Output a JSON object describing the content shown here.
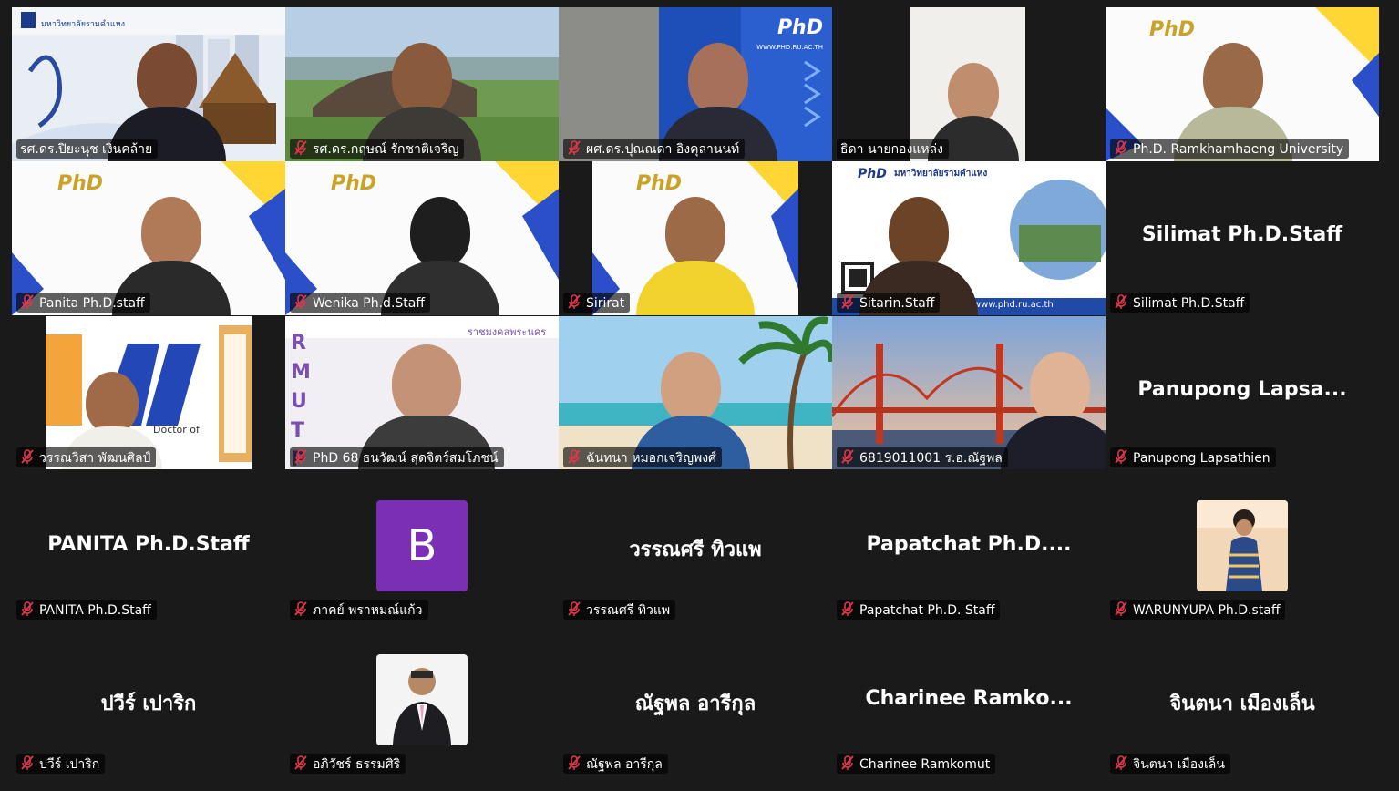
{
  "colors": {
    "background": "#1a1a1a",
    "active_speaker_border": "#3ddc84",
    "muted_icon": "#e0374a",
    "name_tag_bg": "rgba(0,0,0,0.62)",
    "avatar_b_bg": "#7b2fb5"
  },
  "icons": {
    "muted": "muted-microphone-icon"
  },
  "phd_logo_text": "PhD",
  "banner_texts": {
    "sitarin_title": "มหาวิทยาลัยรามคำแหง",
    "sitarin_url": "www.phd.ru.ac.th",
    "logo_university": "มหาวิทยาลัยรามคำแหง",
    "rmutp_letters": "RMUTP",
    "rmutp_header": "ราชมงคลพระนคร",
    "doctor_text": "Doctor of",
    "phd_url": "WWW.PHD.RU.AC.TH"
  },
  "tiles": [
    {
      "name": "รศ.ดร.ปิยะนุช เงินคล้าย",
      "muted": false,
      "active": true,
      "type": "video",
      "bg": "ramkhamhaeng-temple"
    },
    {
      "name": "รศ.ดร.กฤษณ์ รักชาติเจริญ",
      "muted": true,
      "type": "video",
      "bg": "green-campus"
    },
    {
      "name": "ผศ.ดร.ปุณณดา อิงคุลานนท์",
      "muted": true,
      "type": "video",
      "bg": "phd-blue"
    },
    {
      "name": "ธิดา นายกองแหล่ง",
      "muted": false,
      "type": "video",
      "bg": "white-wall"
    },
    {
      "name": "Ph.D. Ramkhamhaeng University",
      "muted": true,
      "type": "video",
      "bg": "phd-banner"
    },
    {
      "name": "Panita Ph.D.staff",
      "muted": true,
      "type": "video",
      "bg": "phd-banner"
    },
    {
      "name": "Wenika Ph.d.Staff",
      "muted": true,
      "type": "video",
      "bg": "phd-banner"
    },
    {
      "name": "Sirirat",
      "muted": true,
      "type": "video",
      "bg": "phd-banner-narrow"
    },
    {
      "name": "Sitarin.Staff",
      "muted": true,
      "type": "video",
      "bg": "phd-poster"
    },
    {
      "name": "Silimat Ph.D.Staff",
      "muted": true,
      "type": "name",
      "display_name": "Silimat Ph.D.Staff"
    },
    {
      "name": "วรรณวิสา พัฒนศิลป์",
      "muted": true,
      "type": "video",
      "bg": "phd-orange-narrow"
    },
    {
      "name": "PhD 68 ธนวัฒน์ สุดจิตร์สมโภชน์",
      "muted": true,
      "type": "video",
      "bg": "rmutp"
    },
    {
      "name": "ฉันทนา หมอกเจริญพงศ์",
      "muted": true,
      "type": "video",
      "bg": "beach"
    },
    {
      "name": "6819011001 ร.อ.ณัฐพล",
      "muted": true,
      "type": "video",
      "bg": "golden-gate"
    },
    {
      "name": "Panupong Lapsathien",
      "muted": true,
      "type": "name",
      "display_name": "Panupong  Lapsa..."
    },
    {
      "name": "PANITA Ph.D.Staff",
      "muted": true,
      "type": "name",
      "display_name": "PANITA Ph.D.Staff"
    },
    {
      "name": "ภาคย์ พราหมณ์แก้ว",
      "muted": true,
      "type": "avatar",
      "avatar": "avatar-letter-b",
      "letter": "B"
    },
    {
      "name": "วรรณศรี ทิวแพ",
      "muted": true,
      "type": "name",
      "display_name": "วรรณศรี  ทิวแพ"
    },
    {
      "name": "Papatchat Ph.D. Staff",
      "muted": true,
      "type": "name",
      "display_name": "Papatchat  Ph.D...."
    },
    {
      "name": "WARUNYUPA Ph.D.staff",
      "muted": true,
      "type": "avatar",
      "avatar": "avatar-photo-woman"
    },
    {
      "name": "ปวีร์ เปาริก",
      "muted": true,
      "type": "name",
      "display_name": "ปวีร์  เปาริก"
    },
    {
      "name": "อภิวัชร์ ธรรมศิริ",
      "muted": true,
      "type": "avatar",
      "avatar": "avatar-photo-man"
    },
    {
      "name": "ณัฐพล อารีกุล",
      "muted": true,
      "type": "name",
      "display_name": "ณัฐพล  อารีกุล"
    },
    {
      "name": "Charinee Ramkomut",
      "muted": true,
      "type": "name",
      "display_name": "Charinee  Ramko..."
    },
    {
      "name": "จินตนา เมืองเล็น",
      "muted": true,
      "type": "name",
      "display_name": "จินตนา  เมืองเล็น"
    }
  ]
}
